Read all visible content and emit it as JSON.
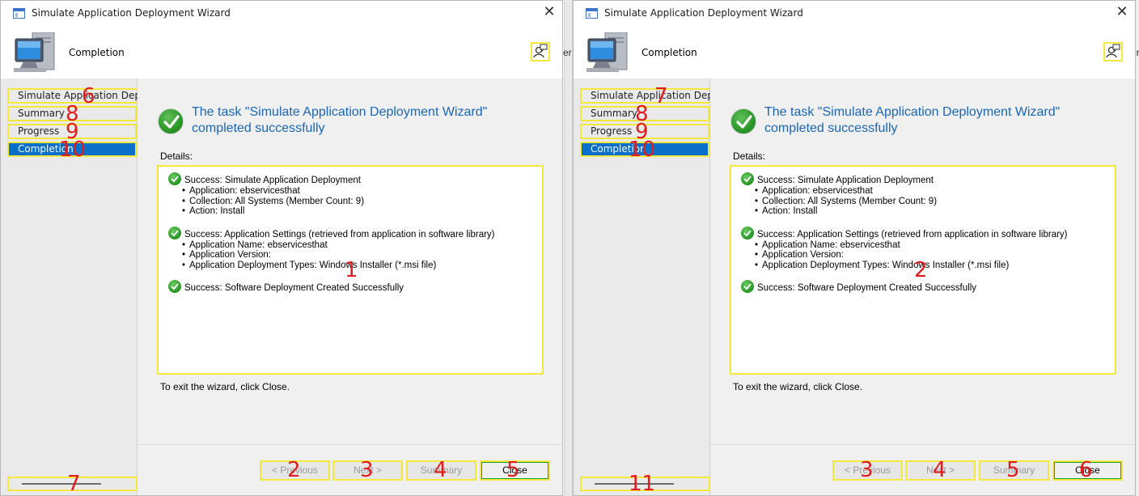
{
  "wizards": [
    {
      "title": "Simulate Application Deployment Wizard",
      "close_symbol": "✕",
      "header_title": "Completion",
      "nav": [
        {
          "label": "Simulate Application Deploy",
          "marker": "6"
        },
        {
          "label": "Summary",
          "marker": "8"
        },
        {
          "label": "Progress",
          "marker": "9"
        },
        {
          "label": "Completion",
          "marker": "10"
        }
      ],
      "headline": "The task \"Simulate Application Deployment Wizard\" completed successfully",
      "details_label": "Details:",
      "details": [
        {
          "title": "Success: Simulate Application Deployment",
          "items": [
            "Application: ebservicesthat",
            "Collection: All Systems (Member Count: 9)",
            "Action: Install"
          ]
        },
        {
          "title": "Success: Application Settings (retrieved from application in software library)",
          "items": [
            "Application Name: ebservicesthat",
            "Application Version:",
            "Application Deployment Types: Windows Installer (*.msi file)"
          ]
        },
        {
          "title": "Success: Software Deployment Created Successfully",
          "items": []
        }
      ],
      "details_marker": "1",
      "exit_text": "To exit the wizard, click Close.",
      "buttons": {
        "previous": "< Previous",
        "previous_marker": "2",
        "next": "Next >",
        "next_marker": "3",
        "summary": "Summary",
        "summary_marker": "4",
        "close": "Close",
        "close_marker": "5"
      },
      "handle_marker": "7"
    },
    {
      "title": "Simulate Application Deployment Wizard",
      "close_symbol": "✕",
      "header_title": "Completion",
      "nav": [
        {
          "label": "Simulate Application Deploy",
          "marker": "7"
        },
        {
          "label": "Summary",
          "marker": "8"
        },
        {
          "label": "Progress",
          "marker": "9"
        },
        {
          "label": "Completion",
          "marker": "10"
        }
      ],
      "headline": "The task \"Simulate Application Deployment Wizard\" completed successfully",
      "details_label": "Details:",
      "details": [
        {
          "title": "Success: Simulate Application Deployment",
          "items": [
            "Application: ebservicesthat",
            "Collection: All Systems (Member Count: 9)",
            "Action: Install"
          ]
        },
        {
          "title": "Success: Application Settings (retrieved from application in software library)",
          "items": [
            "Application Name: ebservicesthat",
            "Application Version:",
            "Application Deployment Types: Windows Installer (*.msi file)"
          ]
        },
        {
          "title": "Success: Software Deployment Created Successfully",
          "items": []
        }
      ],
      "details_marker": "2",
      "exit_text": "To exit the wizard, click Close.",
      "buttons": {
        "previous": "< Previous",
        "previous_marker": "3",
        "next": "Next >",
        "next_marker": "4",
        "summary": "Summary",
        "summary_marker": "5",
        "close": "Close",
        "close_marker": "6"
      },
      "handle_marker": "11"
    }
  ],
  "background_edge_text": "er",
  "colors": {
    "accent": "#0a6fc8",
    "headline": "#1a66b5",
    "highlight": "#f5e83c",
    "marker": "#e11c1c"
  }
}
